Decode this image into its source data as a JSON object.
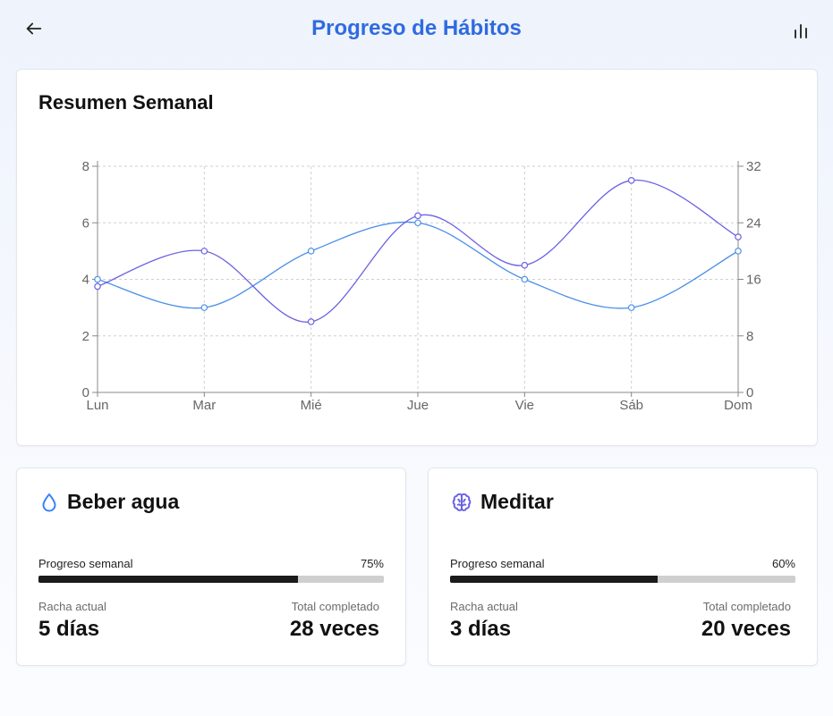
{
  "header": {
    "title": "Progreso de Hábitos",
    "back_icon": "arrow-left-icon",
    "stats_icon": "bar-chart-icon"
  },
  "summary": {
    "title": "Resumen Semanal",
    "chart_data": {
      "type": "line",
      "categories": [
        "Lun",
        "Mar",
        "Mié",
        "Jue",
        "Vie",
        "Sáb",
        "Dom"
      ],
      "series": [
        {
          "name": "",
          "axis": "left",
          "color": "#4a8fe8",
          "values": [
            4,
            3,
            5,
            6,
            4,
            3,
            5
          ]
        },
        {
          "name": "",
          "axis": "right",
          "color": "#6b62e3",
          "values": [
            15,
            20,
            10,
            25,
            18,
            30,
            22
          ]
        }
      ],
      "y_left": {
        "ticks": [
          0,
          2,
          4,
          6,
          8
        ],
        "lim": [
          0,
          8
        ]
      },
      "y_right": {
        "ticks": [
          0,
          8,
          16,
          24,
          32
        ],
        "lim": [
          0,
          32
        ]
      },
      "grid": true
    }
  },
  "habits": [
    {
      "name": "Beber agua",
      "icon": "water-drop-icon",
      "icon_color": "#3b82f6",
      "progress_label": "Progreso semanal",
      "progress": 0.75,
      "progress_text": "75%",
      "streak_label": "Racha actual",
      "streak_value": "5 días",
      "total_label": "Total completado",
      "total_value": "28 veces"
    },
    {
      "name": "Meditar",
      "icon": "brain-icon",
      "icon_color": "#6b62e3",
      "progress_label": "Progreso semanal",
      "progress": 0.6,
      "progress_text": "60%",
      "streak_label": "Racha actual",
      "streak_value": "3 días",
      "total_label": "Total completado",
      "total_value": "20 veces"
    }
  ]
}
